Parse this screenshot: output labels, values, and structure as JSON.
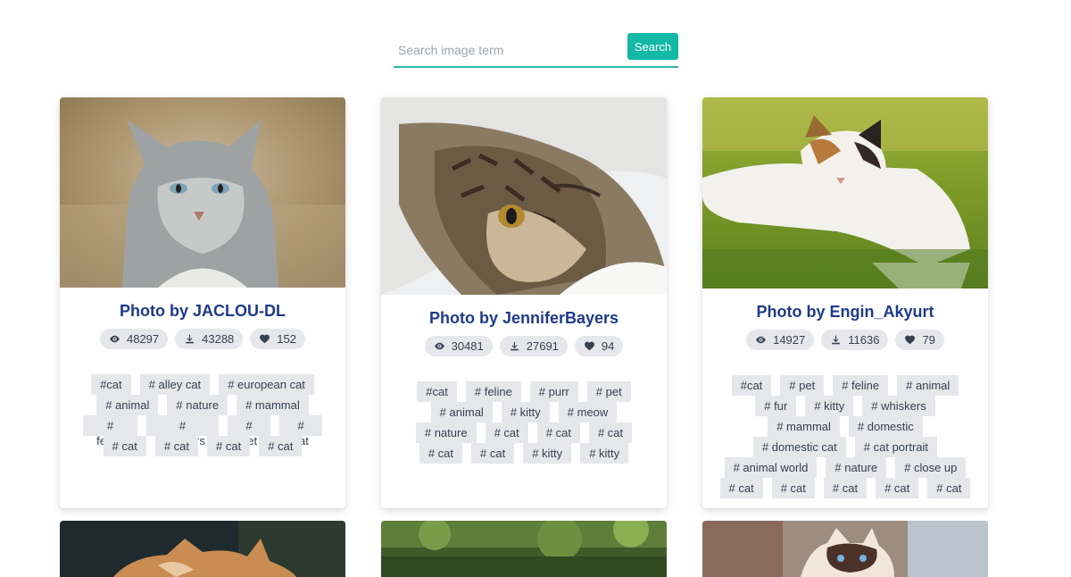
{
  "search": {
    "placeholder": "Search image term",
    "value": "",
    "button_label": "Search"
  },
  "cards": [
    {
      "title": "Photo by JACLOU-DL",
      "views": "48297",
      "downloads": "43288",
      "likes": "152",
      "tag_rows": [
        [
          "#cat",
          "# alley cat",
          "# european cat"
        ],
        [
          "# animal",
          "# nature",
          "# mammal"
        ],
        [
          "# feline",
          "# outdoors",
          "# pet",
          "# cat"
        ],
        [
          "# cat",
          "# cat",
          "# cat",
          "# cat"
        ]
      ]
    },
    {
      "title": "Photo by JenniferBayers",
      "views": "30481",
      "downloads": "27691",
      "likes": "94",
      "tag_rows": [
        [
          "#cat",
          "# feline",
          "# purr",
          "# pet"
        ],
        [
          "# animal",
          "# kitty",
          "# meow"
        ],
        [
          "# nature",
          "# cat",
          "# cat",
          "# cat"
        ],
        [
          "# cat",
          "# cat",
          "# kitty",
          "# kitty"
        ]
      ]
    },
    {
      "title": "Photo by Engin_Akyurt",
      "views": "14927",
      "downloads": "11636",
      "likes": "79",
      "tag_rows": [
        [
          "#cat",
          "# pet",
          "# feline",
          "# animal"
        ],
        [
          "# fur",
          "# kitty",
          "# whiskers"
        ],
        [
          "# mammal",
          "# domestic"
        ],
        [
          "# domestic cat",
          "# cat portrait"
        ],
        [
          "# animal world",
          "# nature",
          "# close up"
        ],
        [
          "# cat",
          "# cat",
          "# cat",
          "# cat",
          "# cat"
        ]
      ]
    }
  ],
  "icons": {
    "views": "eye-icon",
    "downloads": "download-icon",
    "likes": "heart-icon"
  },
  "colors": {
    "accent": "#14b8a6",
    "title": "#1e3a8a",
    "pill": "#e5e7eb"
  }
}
